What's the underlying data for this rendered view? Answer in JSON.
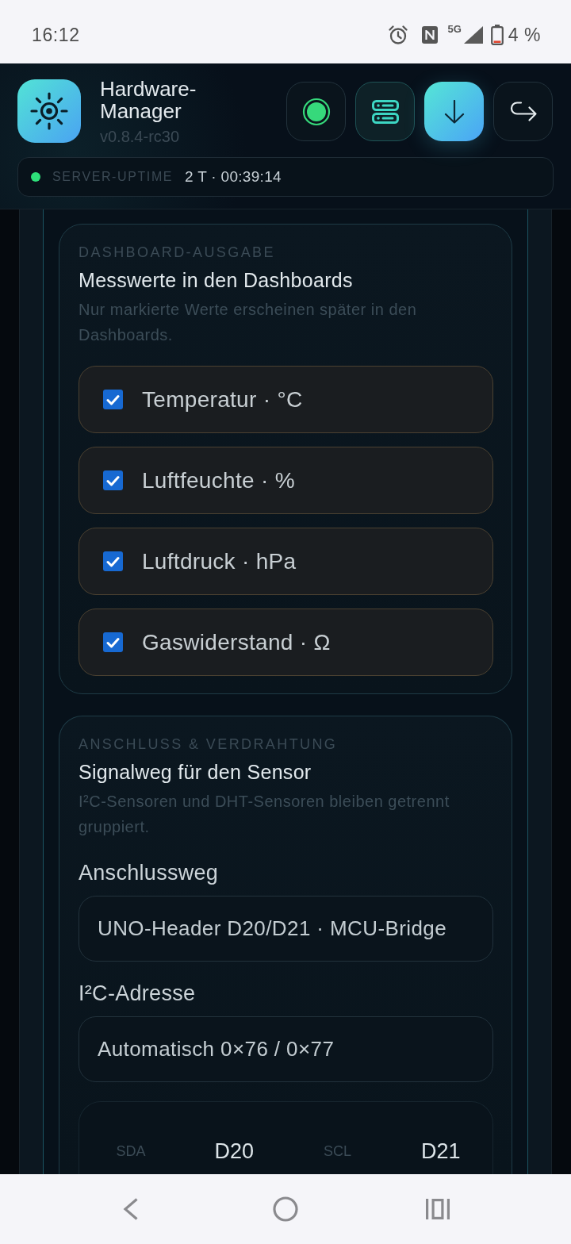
{
  "status_bar": {
    "time": "16:12",
    "network": "5G",
    "battery": "4 %"
  },
  "header": {
    "title": "Hardware-Manager",
    "version": "v0.8.4-rc30",
    "actions": [
      {
        "kind": "status",
        "active": false,
        "primary": false
      },
      {
        "kind": "servers",
        "active": true,
        "primary": false
      },
      {
        "kind": "download",
        "active": false,
        "primary": true
      },
      {
        "kind": "forward",
        "active": false,
        "primary": false
      }
    ],
    "uptime": {
      "online": true,
      "label": "SERVER-UPTIME",
      "value": "2 T · 00:39:14"
    }
  },
  "sections": [
    {
      "overline": "DASHBOARD-AUSGABE",
      "title": "Messwerte in den Dashboards",
      "description": "Nur markierte Werte erscheinen später in den Dashboards.",
      "options": [
        {
          "label": "Temperatur · °C",
          "checked": true
        },
        {
          "label": "Luftfeuchte · %",
          "checked": true
        },
        {
          "label": "Luftdruck · hPa",
          "checked": true
        },
        {
          "label": "Gaswiderstand · Ω",
          "checked": true
        }
      ]
    },
    {
      "overline": "ANSCHLUSS & VERDRAHTUNG",
      "title": "Signalweg für den Sensor",
      "description": "I²C-Sensoren und DHT-Sensoren bleiben getrennt gruppiert.",
      "fields": [
        {
          "label": "Anschlussweg",
          "value": "UNO-Header D20/D21 · MCU-Bridge"
        },
        {
          "label": "I²C-Adresse",
          "value": "Automatisch 0×76 / 0×77"
        }
      ],
      "pins": [
        {
          "label": "SDA",
          "value": "D20"
        },
        {
          "label": "SCL",
          "value": "D21"
        }
      ]
    }
  ]
}
